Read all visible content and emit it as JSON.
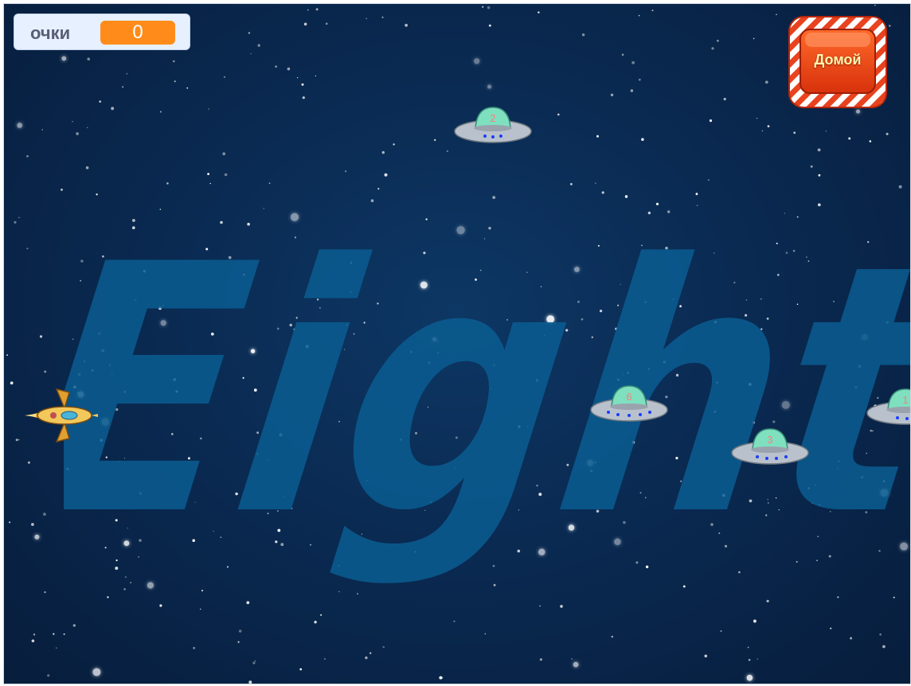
{
  "score": {
    "label": "очки",
    "value": "0",
    "accent": "#ff8c1a"
  },
  "home_button": {
    "label": "Домой"
  },
  "background_word": "Eight",
  "ufos": [
    {
      "number": "2"
    },
    {
      "number": "6"
    },
    {
      "number": "3"
    },
    {
      "number": "1"
    }
  ],
  "colors": {
    "space": "#0a2a52",
    "word": "#0d5a8e",
    "ufo_dome": "#7fe0c0",
    "ufo_number": "#ff7a7a"
  }
}
